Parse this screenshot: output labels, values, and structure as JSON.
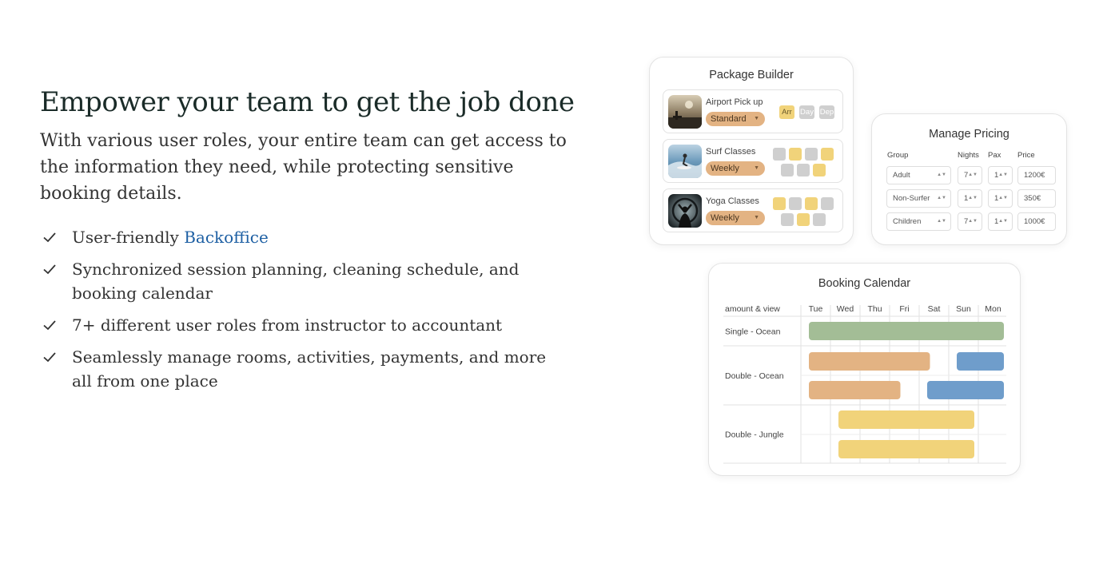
{
  "hero": {
    "title": "Empower your team to get the job done",
    "subtitle": "With various user roles, your entire team can get access to the information they need, while protecting sensitive booking details."
  },
  "features": [
    {
      "text": "User-friendly ",
      "link": "Backoffice"
    },
    {
      "text": "Synchronized session planning, cleaning schedule, and booking calendar"
    },
    {
      "text": "7+ different user roles from instructor to accountant"
    },
    {
      "text": "Seamlessly manage rooms, activities, payments, and more all from one place"
    }
  ],
  "package_builder": {
    "title": "Package Builder",
    "items": [
      {
        "name": "Airport Pick up",
        "option": "Standard",
        "chips": [
          "Arr",
          "Day",
          "Dep"
        ]
      },
      {
        "name": "Surf Classes",
        "option": "Weekly"
      },
      {
        "name": "Yoga Classes",
        "option": "Weekly"
      }
    ]
  },
  "pricing": {
    "title": "Manage Pricing",
    "headers": {
      "group": "Group",
      "nights": "Nights",
      "pax": "Pax",
      "price": "Price"
    },
    "rows": [
      {
        "group": "Adult",
        "nights": "7",
        "pax": "1",
        "price": "1200€"
      },
      {
        "group": "Non-Surfer",
        "nights": "1",
        "pax": "1",
        "price": "350€"
      },
      {
        "group": "Children",
        "nights": "7",
        "pax": "1",
        "price": "1000€"
      }
    ]
  },
  "calendar": {
    "title": "Booking Calendar",
    "corner_label": "amount & view",
    "days": [
      "Tue",
      "Wed",
      "Thu",
      "Fri",
      "Sat",
      "Sun",
      "Mon"
    ],
    "rooms": [
      "Single - Ocean",
      "Double - Ocean",
      "Double - Jungle"
    ],
    "bookings": [
      {
        "room": 0,
        "lane": 0,
        "start": 0,
        "end": 7,
        "color": "#a3bd96"
      },
      {
        "room": 1,
        "lane": 0,
        "start": 0,
        "end": 4.5,
        "color": "#e3b383"
      },
      {
        "room": 1,
        "lane": 0,
        "start": 5,
        "end": 7,
        "color": "#6f9dcb"
      },
      {
        "room": 1,
        "lane": 1,
        "start": 0,
        "end": 3.5,
        "color": "#e3b383"
      },
      {
        "room": 1,
        "lane": 1,
        "start": 4,
        "end": 7,
        "color": "#6f9dcb"
      },
      {
        "room": 2,
        "lane": 0,
        "start": 1,
        "end": 6,
        "color": "#f1d37a"
      },
      {
        "room": 2,
        "lane": 1,
        "start": 1,
        "end": 6,
        "color": "#f1d37a"
      }
    ]
  },
  "colors": {
    "accent_link": "#1d5fa3",
    "heading": "#1a2b28",
    "option_pill": "#e3b383",
    "chip_active": "#f1d37a",
    "chip_inactive": "#cfcfcf"
  }
}
